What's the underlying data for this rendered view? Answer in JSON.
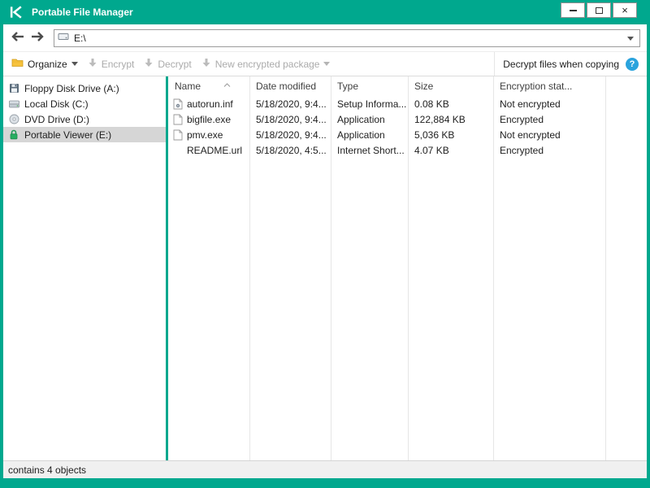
{
  "window": {
    "title": "Portable File Manager"
  },
  "icons": {
    "close": "×",
    "help": "?"
  },
  "colors": {
    "brand_teal": "#00a88e",
    "help_blue": "#2aa3dd",
    "selected_bg": "#d6d6d6"
  },
  "address_bar": {
    "path": "E:\\"
  },
  "toolbar": {
    "organize_label": "Organize",
    "encrypt_label": "Encrypt",
    "decrypt_label": "Decrypt",
    "new_package_label": "New encrypted package",
    "decrypt_when_copying_label": "Decrypt files when copying"
  },
  "sidebar": {
    "items": [
      {
        "label": "Floppy Disk Drive (A:)",
        "icon": "floppy-icon",
        "selected": false
      },
      {
        "label": "Local Disk (C:)",
        "icon": "hard-disk-icon",
        "selected": false
      },
      {
        "label": "DVD Drive (D:)",
        "icon": "dvd-icon",
        "selected": false
      },
      {
        "label": "Portable Viewer (E:)",
        "icon": "lock-icon",
        "selected": true
      }
    ]
  },
  "file_list": {
    "columns": [
      "Name",
      "Date modified",
      "Type",
      "Size",
      "Encryption stat..."
    ],
    "rows": [
      {
        "name": "autorun.inf",
        "date": "5/18/2020, 9:4...",
        "type": "Setup Informa...",
        "size": "0.08 KB",
        "encryption": "Not encrypted",
        "icon": "setup-file-icon"
      },
      {
        "name": "bigfile.exe",
        "date": "5/18/2020, 9:4...",
        "type": "Application",
        "size": "122,884 KB",
        "encryption": "Encrypted",
        "icon": "file-icon"
      },
      {
        "name": "pmv.exe",
        "date": "5/18/2020, 9:4...",
        "type": "Application",
        "size": "5,036 KB",
        "encryption": "Not encrypted",
        "icon": "file-icon"
      },
      {
        "name": "README.url",
        "date": "5/18/2020, 4:5...",
        "type": "Internet Short...",
        "size": "4.07 KB",
        "encryption": "Encrypted",
        "icon": "none"
      }
    ]
  },
  "status_bar": {
    "text": "contains 4 objects"
  }
}
